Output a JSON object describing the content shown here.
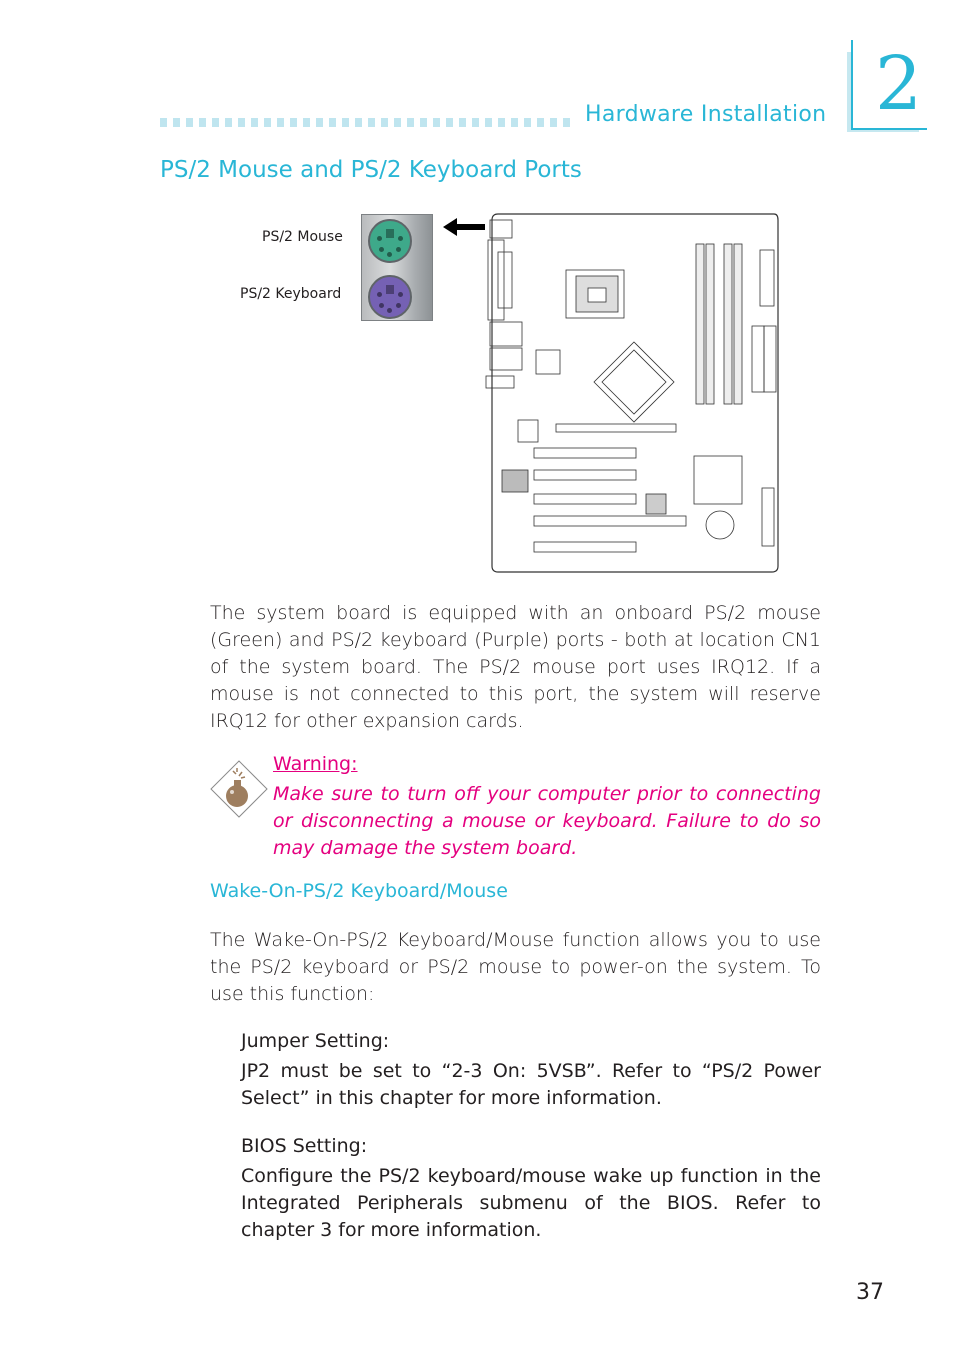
{
  "header": {
    "section_title": "Hardware Installation",
    "chapter_number": "2",
    "accent_color": "#29b6d6"
  },
  "page": {
    "heading": "PS/2 Mouse and PS/2 Keyboard Ports",
    "page_number": "37"
  },
  "figure": {
    "label_mouse": "PS/2  Mouse",
    "label_keyboard": "PS/2  Keyboard",
    "mouse_port_color": "#3ea98a",
    "keyboard_port_color": "#7561b4",
    "arrow_icon": "arrow-left-icon",
    "board_diagram": "motherboard-layout-diagram"
  },
  "body": {
    "intro": "The system board is equipped with an onboard PS/2 mouse (Green) and PS/2 keyboard (Purple) ports - both at location CN1 of the system board. The PS/2 mouse port uses IRQ12. If a mouse is not connected to this port, the system will reserve IRQ12 for other expansion cards.",
    "warning": {
      "icon": "bomb-warning-icon",
      "title": "Warning:",
      "text": "Make sure to turn off your computer prior to connecting or disconnecting a mouse or keyboard. Failure to do so may damage the system board.",
      "color": "#e4007f"
    },
    "wake_heading": "Wake-On-PS/2  Keyboard/Mouse",
    "wake_text": "The Wake-On-PS/2 Keyboard/Mouse function allows you to use the PS/2 keyboard or PS/2 mouse to power-on the system. To use this function:",
    "jumper": {
      "title": "Jumper  Setting:",
      "text": "JP2 must be set to “2-3 On: 5VSB”. Refer to “PS/2 Power Select” in this chapter for more information."
    },
    "bios": {
      "title": "BIOS Setting:",
      "text": "Configure the PS/2 keyboard/mouse wake up function in the Integrated Peripherals submenu of the BIOS. Refer to chapter 3 for more information."
    }
  }
}
